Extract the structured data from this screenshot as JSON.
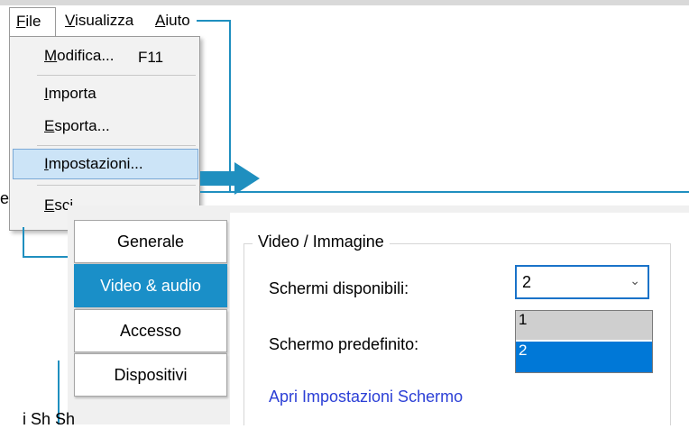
{
  "menubar": {
    "items": [
      {
        "label": "File",
        "mnemonic": "F"
      },
      {
        "label": "Visualizza",
        "mnemonic": "V"
      },
      {
        "label": "Aiuto",
        "mnemonic": "A"
      }
    ]
  },
  "file_menu": {
    "modifica": "Modifica...",
    "modifica_shortcut": "F11",
    "importa": "Importa",
    "esporta": "Esporta...",
    "impostazioni": "Impostazioni...",
    "esci": "Esci"
  },
  "settings": {
    "tabs": [
      "Generale",
      "Video & audio",
      "Accesso",
      "Dispositivi"
    ],
    "active_tab": "Video & audio",
    "group_title": "Video / Immagine",
    "screens_label": "Schermi disponibili:",
    "screens_value": "2",
    "screens_options": [
      "1",
      "2"
    ],
    "default_screen_label": "Schermo predefinito:",
    "open_display_settings_link": "Apri Impostazioni Schermo"
  },
  "fragments": {
    "left_edge_text": "e",
    "bottom_text": "i   Sh   Sh"
  },
  "colors": {
    "accent": "#1a8fc8",
    "callout": "#1f8fbf",
    "selection": "#0078d7",
    "link": "#2b3fd6"
  }
}
